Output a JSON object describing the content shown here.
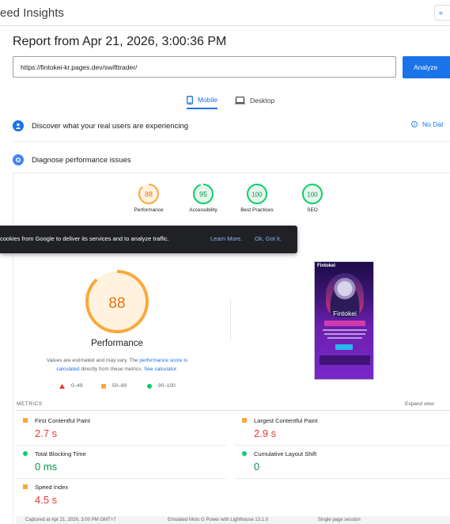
{
  "header": {
    "title": "eed Insights",
    "share_label": "«"
  },
  "report": {
    "title": "Report from Apr 21, 2026, 3:00:36 PM"
  },
  "form": {
    "url": "https://fintokei-kr.pages.dev/swifttrader/",
    "analyze_label": "Analyze"
  },
  "tabs": [
    {
      "label": "Mobile",
      "icon": "phone-icon",
      "active": true
    },
    {
      "label": "Desktop",
      "icon": "laptop-icon",
      "active": false
    }
  ],
  "crux": {
    "label": "Discover what your real users are experiencing",
    "no_data": "No Dat"
  },
  "diagnose": {
    "label": "Diagnose performance issues"
  },
  "summary": [
    {
      "label": "Performance",
      "score": "88",
      "score_value": 88,
      "color": "#e8710a",
      "ring": "#fba83a",
      "fill": "#fff3e0"
    },
    {
      "label": "Accessibility",
      "score": "95",
      "score_value": 95,
      "color": "#0d904f",
      "ring": "#0cce6b",
      "fill": "#e6f7ec"
    },
    {
      "label": "Best Practices",
      "score": "100",
      "score_value": 100,
      "color": "#0d904f",
      "ring": "#0cce6b",
      "fill": "#e6f7ec"
    },
    {
      "label": "SEO",
      "score": "100",
      "score_value": 100,
      "color": "#0d904f",
      "ring": "#0cce6b",
      "fill": "#e6f7ec"
    }
  ],
  "cookie": {
    "message": "cookies from Google to deliver its services and to analyze traffic.",
    "learn_more": "Learn More.",
    "ok": "Ok, Got it."
  },
  "performance": {
    "score": "88",
    "score_value": 88,
    "label": "Performance",
    "note_pre": "Values are estimated and may vary. The ",
    "note_link1": "performance score is calculated",
    "note_mid": " directly from these metrics. ",
    "note_link2": "See calculator."
  },
  "legend": [
    {
      "range": "0–49",
      "marker": "triangle",
      "color": "#e53935"
    },
    {
      "range": "50–89",
      "marker": "square",
      "color": "#fba83a"
    },
    {
      "range": "90–100",
      "marker": "circle",
      "color": "#0cce6b"
    }
  ],
  "screenshot": {
    "brand": "Fintokei",
    "word": "Fintokei"
  },
  "metrics": {
    "header": "METRICS",
    "expand": "Expand view",
    "items": [
      {
        "name": "First Contentful Paint",
        "value": "2.7 s",
        "status": "average",
        "color": "#e53935"
      },
      {
        "name": "Largest Contentful Paint",
        "value": "2.9 s",
        "status": "average",
        "color": "#e53935"
      },
      {
        "name": "Total Blocking Time",
        "value": "0 ms",
        "status": "pass",
        "color": "#0d904f"
      },
      {
        "name": "Cumulative Layout Shift",
        "value": "0",
        "status": "pass",
        "color": "#0d904f"
      },
      {
        "name": "Speed Index",
        "value": "4.5 s",
        "status": "average",
        "color": "#e53935"
      }
    ]
  },
  "footer": {
    "captured": "Captured at Apr 21, 2026, 3:00 PM GMT+7",
    "device": "Emulated Moto G Power with Lighthouse 13.1.0",
    "session": "Single page session"
  }
}
